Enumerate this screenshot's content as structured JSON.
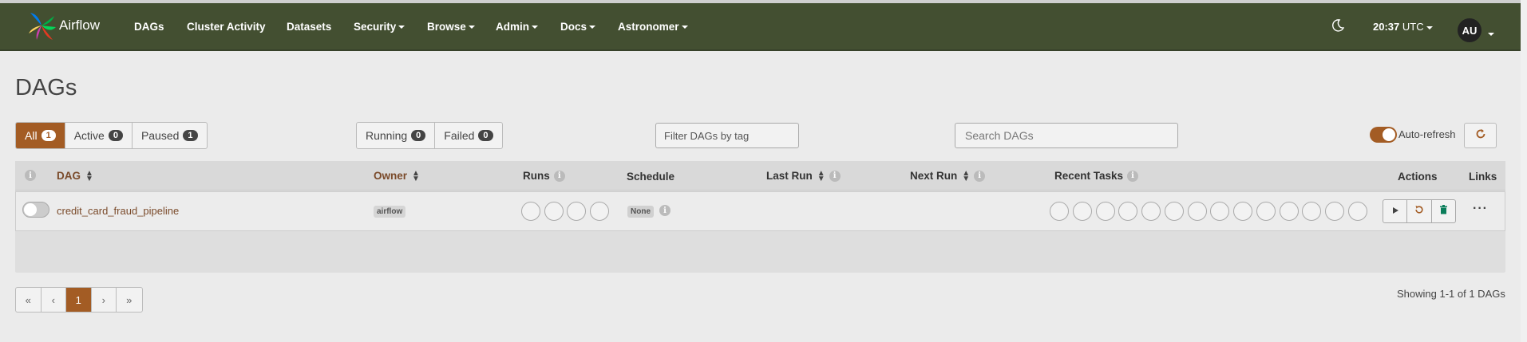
{
  "navbar": {
    "brand": "Airflow",
    "items": [
      {
        "label": "DAGs",
        "dropdown": false
      },
      {
        "label": "Cluster Activity",
        "dropdown": false
      },
      {
        "label": "Datasets",
        "dropdown": false
      },
      {
        "label": "Security",
        "dropdown": true
      },
      {
        "label": "Browse",
        "dropdown": true
      },
      {
        "label": "Admin",
        "dropdown": true
      },
      {
        "label": "Docs",
        "dropdown": true
      },
      {
        "label": "Astronomer",
        "dropdown": true
      }
    ],
    "theme_icon": "moon-icon",
    "time": "20:37",
    "timezone": "UTC",
    "user_initials": "AU",
    "colors": {
      "navbar_bg": "#434f31",
      "accent": "#a35c24"
    }
  },
  "page": {
    "title": "DAGs"
  },
  "filters": {
    "status": [
      {
        "label": "All",
        "count": "1",
        "active": true
      },
      {
        "label": "Active",
        "count": "0",
        "active": false
      },
      {
        "label": "Paused",
        "count": "1",
        "active": false
      }
    ],
    "runs": [
      {
        "label": "Running",
        "count": "0"
      },
      {
        "label": "Failed",
        "count": "0"
      }
    ],
    "tag_placeholder": "Filter DAGs by tag",
    "search_placeholder": "Search DAGs",
    "auto_refresh_label": "Auto-refresh",
    "auto_refresh_on": true
  },
  "table": {
    "headers": {
      "dag": "DAG",
      "owner": "Owner",
      "runs": "Runs",
      "schedule": "Schedule",
      "last_run": "Last Run",
      "next_run": "Next Run",
      "recent_tasks": "Recent Tasks",
      "actions": "Actions",
      "links": "Links"
    },
    "rows": [
      {
        "dag_id": "credit_card_fraud_pipeline",
        "owner": "airflow",
        "schedule": "None",
        "last_run": "",
        "next_run": "",
        "paused": true
      }
    ]
  },
  "pagination": {
    "first": "«",
    "prev": "‹",
    "current": "1",
    "next": "›",
    "last": "»",
    "showing": "Showing 1-1 of 1 DAGs"
  }
}
